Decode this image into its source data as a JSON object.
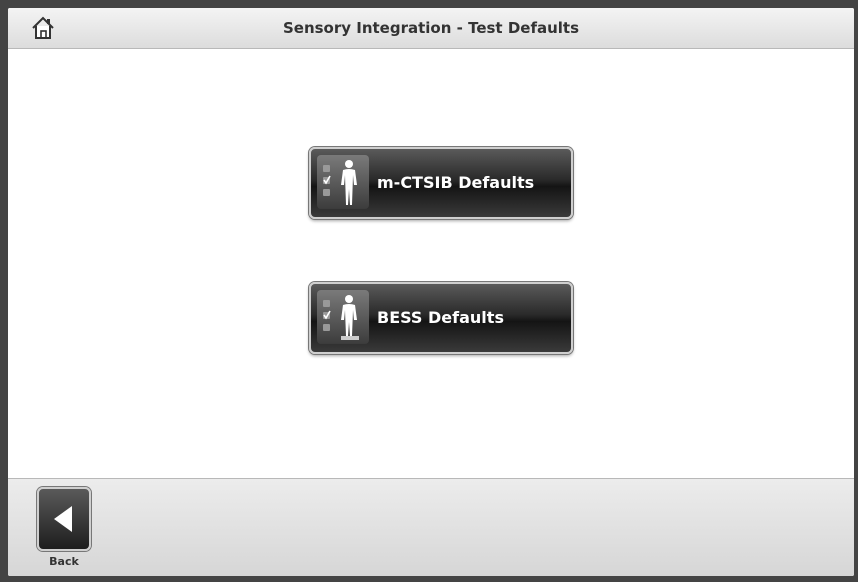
{
  "header": {
    "title": "Sensory Integration - Test Defaults",
    "home_icon": "home-icon"
  },
  "main": {
    "buttons": [
      {
        "label": "m-CTSIB Defaults",
        "icon": "person-checklist-icon"
      },
      {
        "label": "BESS Defaults",
        "icon": "person-checklist-platform-icon"
      }
    ]
  },
  "footer": {
    "back_label": "Back",
    "back_icon": "back-arrow-icon"
  }
}
